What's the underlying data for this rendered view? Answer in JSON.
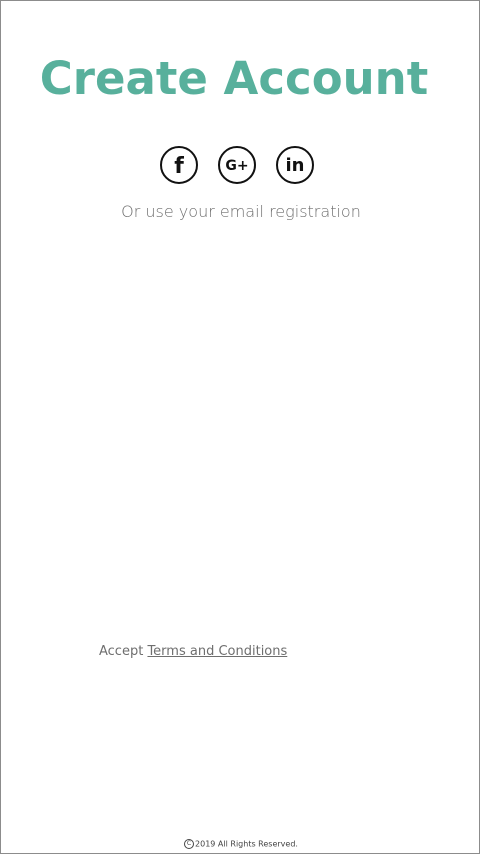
{
  "header": {
    "title": "Create Account",
    "title_color": "#58b09c"
  },
  "social": {
    "buttons": [
      {
        "name": "facebook",
        "icon": "facebook-icon"
      },
      {
        "name": "google-plus",
        "icon": "google-plus-icon"
      },
      {
        "name": "linkedin",
        "icon": "linkedin-icon"
      }
    ],
    "facebook_glyph": "f",
    "google_glyph": "G+",
    "linkedin_glyph": "in"
  },
  "subtitle": "Or use your email registration",
  "terms": {
    "prefix": "Accept",
    "link_label": "Terms and Conditions"
  },
  "footer": {
    "copyright_symbol": "C",
    "text": "2019 All Rights Reserved."
  }
}
